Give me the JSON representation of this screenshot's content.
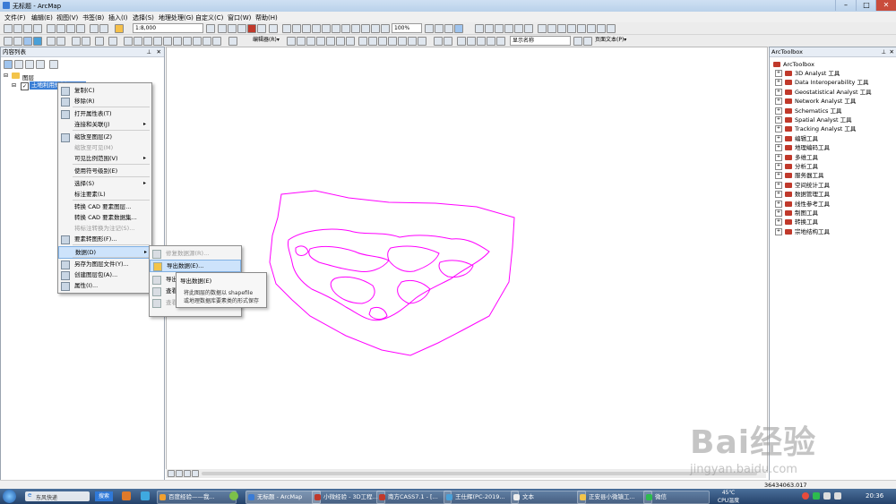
{
  "window": {
    "title": "无标题 - ArcMap",
    "min": "–",
    "max": "□",
    "close": "✕"
  },
  "menubar": [
    "文件(F)",
    "编辑(E)",
    "视图(V)",
    "书签(B)",
    "插入(I)",
    "选择(S)",
    "地理处理(G)",
    "自定义(C)",
    "窗口(W)",
    "帮助(H)"
  ],
  "toolbar1": {
    "scale": "1:8,000",
    "zoom": "100%"
  },
  "toolbar2": {
    "editor": "编辑器(R)▾",
    "display_field": "显示名称",
    "page_text": "页面文本(P)▾"
  },
  "toc": {
    "title": "内容列表",
    "pin": "📌",
    "close": "✕",
    "root": "图层",
    "layer": "土地利用规划图.shp"
  },
  "context_menu": {
    "items": [
      {
        "label": "复制(C)",
        "icon": "copy-icon"
      },
      {
        "label": "移除(R)",
        "icon": "remove-icon"
      },
      {
        "label": "打开属性表(T)",
        "icon": "table-icon"
      },
      {
        "label": "连接和关联(J)",
        "submenu": true
      },
      {
        "label": "缩放至图层(Z)",
        "icon": "zoom-layer-icon"
      },
      {
        "label": "缩放至可见(M)",
        "disabled": true
      },
      {
        "label": "可见比例范围(V)",
        "submenu": true
      },
      {
        "label": "使用符号级别(E)"
      },
      {
        "label": "选择(S)",
        "submenu": true
      },
      {
        "label": "标注要素(L)"
      },
      {
        "label": "转换 CAD 要素图层..."
      },
      {
        "label": "转换 CAD 要素数据集..."
      },
      {
        "label": "将标注转换为注记(S)...",
        "disabled": true
      },
      {
        "label": "要素转图形(F)...",
        "icon": "feature-graphic-icon"
      },
      {
        "label": "数据(D)",
        "submenu": true,
        "highlight": true
      },
      {
        "label": "另存为图层文件(Y)...",
        "icon": "layer-file-icon"
      },
      {
        "label": "创建图层包(A)...",
        "icon": "layer-package-icon"
      },
      {
        "label": "属性(I)...",
        "icon": "properties-icon"
      }
    ]
  },
  "data_submenu": {
    "items": [
      {
        "label": "修复数据源(R)...",
        "disabled": true
      },
      {
        "label": "导出数据(E)...",
        "highlight": true
      },
      {
        "label": "导出至 CAD..."
      },
      {
        "label": "查看..."
      },
      {
        "label": "查看项目描述(V)...",
        "disabled": true
      }
    ]
  },
  "tooltip": {
    "title": "导出数据(E)",
    "line1": "将此图层的数据以 shapefile",
    "line2": "或地理数据库要素类的形式保存"
  },
  "toolbox": {
    "title": "ArcToolbox",
    "root": "ArcToolbox",
    "items": [
      "3D Analyst 工具",
      "Data Interoperability 工具",
      "Geostatistical Analyst 工具",
      "Network Analyst 工具",
      "Schematics 工具",
      "Spatial Analyst 工具",
      "Tracking Analyst 工具",
      "编辑工具",
      "地理编码工具",
      "多维工具",
      "分析工具",
      "服务器工具",
      "空间统计工具",
      "数据管理工具",
      "线性参考工具",
      "制图工具",
      "转换工具",
      "宗地结构工具"
    ]
  },
  "status": {
    "coords": "36434063.017",
    "temp": "45℃",
    "temp_label": "CPU温度",
    "clock": "20:36"
  },
  "taskbar": {
    "start_label": "东风快递",
    "search_btn": "搜索",
    "tasks": [
      "百度经验——我...",
      "无标题 - ArcMap",
      "小微经验 - 3D工程...",
      "南方CASS7.1 - [...",
      "王仕辉(PC-2019...",
      "文本",
      "正安县小微镇工...",
      "微信"
    ]
  },
  "watermark": {
    "brand": "Bai经验",
    "url": "jingyan.baidu.com"
  },
  "colors": {
    "polygon": "#ff00ff",
    "highlight": "#cde3fb",
    "toolbox_icon": "#c0392b"
  }
}
